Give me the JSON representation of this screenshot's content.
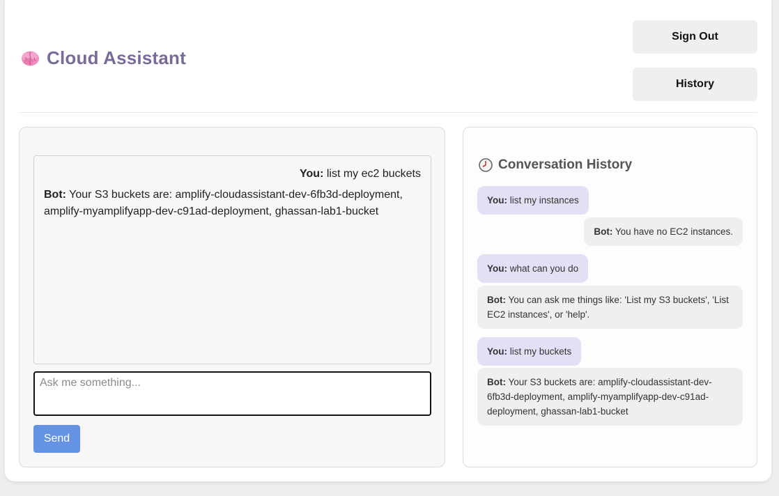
{
  "header": {
    "title": "Cloud Assistant",
    "logo_icon": "brain-icon",
    "sign_out_label": "Sign Out",
    "history_label": "History"
  },
  "chat": {
    "user_label": "You:",
    "bot_label": "Bot:",
    "user_message": "list my ec2 buckets",
    "bot_message": "Your S3 buckets are: amplify-cloudassistant-dev-6fb3d-deployment, amplify-myamplifyapp-dev-c91ad-deployment, ghassan-lab1-bucket",
    "input_placeholder": "Ask me something...",
    "input_value": "",
    "send_label": "Send"
  },
  "history": {
    "title": "Conversation History",
    "title_icon": "clock-icon",
    "items": [
      {
        "role": "You:",
        "text": "list my instances"
      },
      {
        "role": "Bot:",
        "text": "You have no EC2 instances."
      },
      {
        "role": "You:",
        "text": "what can you do"
      },
      {
        "role": "Bot:",
        "text": "You can ask me things like: 'List my S3 buckets', 'List EC2 instances', or 'help'."
      },
      {
        "role": "You:",
        "text": "list my buckets"
      },
      {
        "role": "Bot:",
        "text": "Your S3 buckets are: amplify-cloudassistant-dev-6fb3d-deployment, amplify-myamplifyapp-dev-c91ad-deployment, ghassan-lab1-bucket"
      }
    ]
  },
  "colors": {
    "title": "#7a6a9a",
    "send_button": "#6593e4",
    "user_bubble": "#e3e0f5",
    "bot_bubble": "#efefef"
  }
}
